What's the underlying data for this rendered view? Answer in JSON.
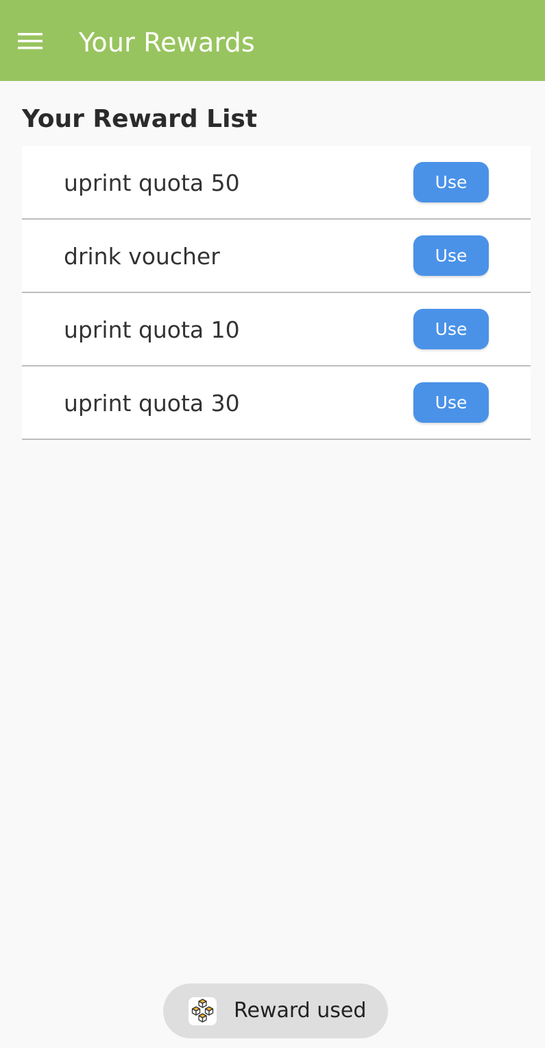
{
  "app_bar": {
    "title": "Your Rewards",
    "menu_icon": "hamburger-menu-icon",
    "color": "#98c45f"
  },
  "section": {
    "title": "Your Reward List"
  },
  "rewards": [
    {
      "name": "uprint quota 50",
      "action_label": "Use"
    },
    {
      "name": "drink voucher",
      "action_label": "Use"
    },
    {
      "name": "uprint quota 10",
      "action_label": "Use"
    },
    {
      "name": "uprint quota 30",
      "action_label": "Use"
    }
  ],
  "accent_color": "#4a92e8",
  "toast": {
    "icon": "app-cubes-icon",
    "text": "Reward used"
  }
}
